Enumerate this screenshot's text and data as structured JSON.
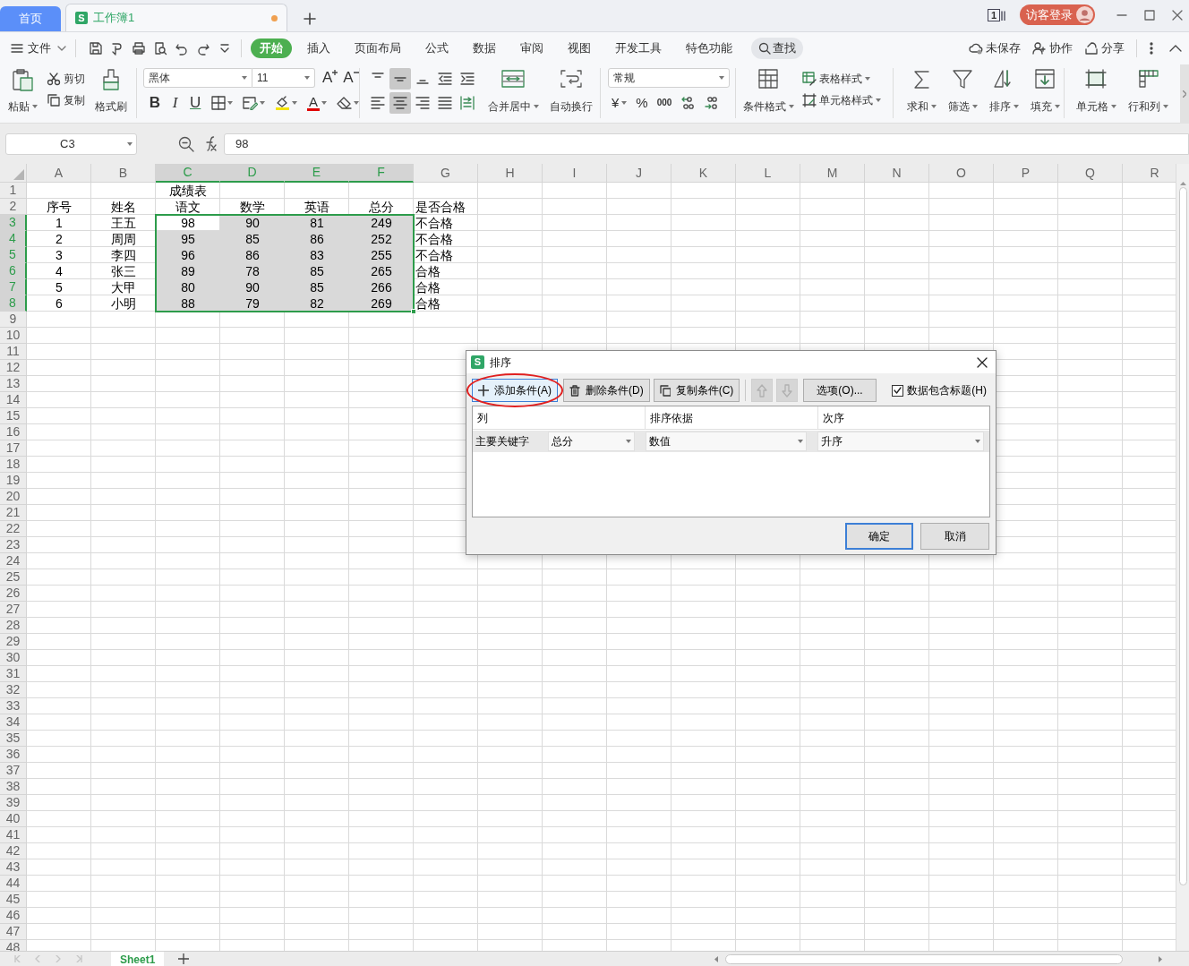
{
  "tabs": [
    {
      "kind": "home",
      "label": "首页",
      "selected": false
    },
    {
      "kind": "doc",
      "badge": "S",
      "label": "工作簿1",
      "selected": true,
      "modified": true
    }
  ],
  "window": {
    "window_count": "1",
    "login": "访客登录"
  },
  "menu": {
    "file": "文件",
    "tabs": [
      {
        "label": "开始",
        "selected": true
      },
      {
        "label": "插入",
        "selected": false
      },
      {
        "label": "页面布局",
        "selected": false
      },
      {
        "label": "公式",
        "selected": false
      },
      {
        "label": "数据",
        "selected": false
      },
      {
        "label": "审阅",
        "selected": false
      },
      {
        "label": "视图",
        "selected": false
      },
      {
        "label": "开发工具",
        "selected": false
      },
      {
        "label": "特色功能",
        "selected": false
      }
    ],
    "search": "查找",
    "actions": [
      "未保存",
      "协作",
      "分享"
    ]
  },
  "ribbon": {
    "clipboard": {
      "paste": "粘贴",
      "cut": "剪切",
      "copy": "复制",
      "format_painter": "格式刷"
    },
    "font": {
      "name": "黑体",
      "size": "11",
      "grow": "A",
      "shrink": "A",
      "bold": "B",
      "italic": "I",
      "underline": "U",
      "font_color": "A"
    },
    "alignment": {
      "vertical": [
        {
          "selected": false
        },
        {
          "selected": true
        },
        {
          "selected": false
        }
      ],
      "horizontal": [
        {
          "selected": false
        },
        {
          "selected": true
        },
        {
          "selected": false
        },
        {
          "selected": false
        }
      ],
      "merge": "合并居中",
      "wrap": "自动换行"
    },
    "number": {
      "format": "常规",
      "currency": "¥",
      "percent": "%",
      "thousands": "000"
    },
    "styles": {
      "conditional": "条件格式",
      "table_style": "表格样式",
      "cell_style": "单元格样式"
    },
    "editing": [
      "求和",
      "筛选",
      "排序",
      "填充"
    ],
    "cells": [
      "单元格",
      "行和列"
    ]
  },
  "formula_bar": {
    "cell_ref": "C3",
    "value": "98"
  },
  "sheet": {
    "columns": [
      {
        "label": "A",
        "selected": false
      },
      {
        "label": "B",
        "selected": false
      },
      {
        "label": "C",
        "selected": true
      },
      {
        "label": "D",
        "selected": true
      },
      {
        "label": "E",
        "selected": true
      },
      {
        "label": "F",
        "selected": true
      },
      {
        "label": "G",
        "selected": false
      },
      {
        "label": "H",
        "selected": false
      },
      {
        "label": "I",
        "selected": false
      },
      {
        "label": "J",
        "selected": false
      },
      {
        "label": "K",
        "selected": false
      },
      {
        "label": "L",
        "selected": false
      },
      {
        "label": "M",
        "selected": false
      },
      {
        "label": "N",
        "selected": false
      },
      {
        "label": "O",
        "selected": false
      },
      {
        "label": "P",
        "selected": false
      },
      {
        "label": "Q",
        "selected": false
      },
      {
        "label": "R",
        "selected": false
      }
    ],
    "rows": [
      {
        "header": "1",
        "selected": false,
        "cells": [
          null,
          null,
          "成绩表",
          null,
          null,
          null,
          null
        ]
      },
      {
        "header": "2",
        "selected": false,
        "cells": [
          "序号",
          "姓名",
          "语文",
          "数学",
          "英语",
          "总分",
          "是否合格"
        ]
      },
      {
        "header": "3",
        "selected": true,
        "cells": [
          "1",
          "王五",
          {
            "text": "98",
            "active": true
          },
          "90",
          "81",
          "249",
          "不合格"
        ]
      },
      {
        "header": "4",
        "selected": true,
        "cells": [
          "2",
          "周周",
          "95",
          "85",
          "86",
          "252",
          "不合格"
        ]
      },
      {
        "header": "5",
        "selected": true,
        "cells": [
          "3",
          "李四",
          "96",
          "86",
          "83",
          "255",
          "不合格"
        ]
      },
      {
        "header": "6",
        "selected": true,
        "cells": [
          "4",
          "张三",
          "89",
          "78",
          "85",
          "265",
          "合格"
        ]
      },
      {
        "header": "7",
        "selected": true,
        "cells": [
          "5",
          "大甲",
          "80",
          "90",
          "85",
          "266",
          "合格"
        ]
      },
      {
        "header": "8",
        "selected": true,
        "cells": [
          "6",
          "小明",
          "88",
          "79",
          "82",
          "269",
          "合格"
        ]
      },
      {
        "header": "9",
        "selected": false
      },
      {
        "header": "10",
        "selected": false
      },
      {
        "header": "11",
        "selected": false
      },
      {
        "header": "12",
        "selected": false
      },
      {
        "header": "13",
        "selected": false
      },
      {
        "header": "14",
        "selected": false
      },
      {
        "header": "15",
        "selected": false
      },
      {
        "header": "16",
        "selected": false
      },
      {
        "header": "17",
        "selected": false
      },
      {
        "header": "18",
        "selected": false
      },
      {
        "header": "19",
        "selected": false
      },
      {
        "header": "20",
        "selected": false
      },
      {
        "header": "21",
        "selected": false
      },
      {
        "header": "22",
        "selected": false
      },
      {
        "header": "23",
        "selected": false
      },
      {
        "header": "24",
        "selected": false
      },
      {
        "header": "25",
        "selected": false
      },
      {
        "header": "26",
        "selected": false
      },
      {
        "header": "27",
        "selected": false
      },
      {
        "header": "28",
        "selected": false
      },
      {
        "header": "29",
        "selected": false
      },
      {
        "header": "30",
        "selected": false
      },
      {
        "header": "31",
        "selected": false
      },
      {
        "header": "32",
        "selected": false
      },
      {
        "header": "33",
        "selected": false
      },
      {
        "header": "34",
        "selected": false
      },
      {
        "header": "35",
        "selected": false
      },
      {
        "header": "36",
        "selected": false
      },
      {
        "header": "37",
        "selected": false
      },
      {
        "header": "38",
        "selected": false
      },
      {
        "header": "39",
        "selected": false
      },
      {
        "header": "40",
        "selected": false
      },
      {
        "header": "41",
        "selected": false
      },
      {
        "header": "42",
        "selected": false
      },
      {
        "header": "43",
        "selected": false
      },
      {
        "header": "44",
        "selected": false
      },
      {
        "header": "45",
        "selected": false
      },
      {
        "header": "46",
        "selected": false
      },
      {
        "header": "47",
        "selected": false
      },
      {
        "header": "48",
        "selected": false
      }
    ]
  },
  "sheet_tabs": [
    {
      "label": "Sheet1",
      "selected": true
    }
  ],
  "dialog": {
    "badge": "S",
    "title": "排序",
    "tools": [
      {
        "kind": "add",
        "label": "添加条件(A)",
        "focused": true,
        "circled": true
      },
      {
        "kind": "delete",
        "label": "删除条件(D)",
        "focused": false,
        "circled": false
      },
      {
        "kind": "copy",
        "label": "复制条件(C)",
        "focused": false,
        "circled": false
      },
      {
        "kind": "up",
        "disabled": true
      },
      {
        "kind": "down",
        "disabled": true
      },
      {
        "kind": "options",
        "label": "选项(O)...",
        "focused": false,
        "circled": false
      }
    ],
    "has_header": {
      "label": "数据包含标题(H)",
      "checked": true
    },
    "columns": [
      "列",
      "排序依据",
      "次序"
    ],
    "conditions": [
      {
        "label": "主要关键字",
        "column": "总分",
        "basis": "数值",
        "order": "升序"
      }
    ],
    "ok": "确定",
    "cancel": "取消"
  }
}
